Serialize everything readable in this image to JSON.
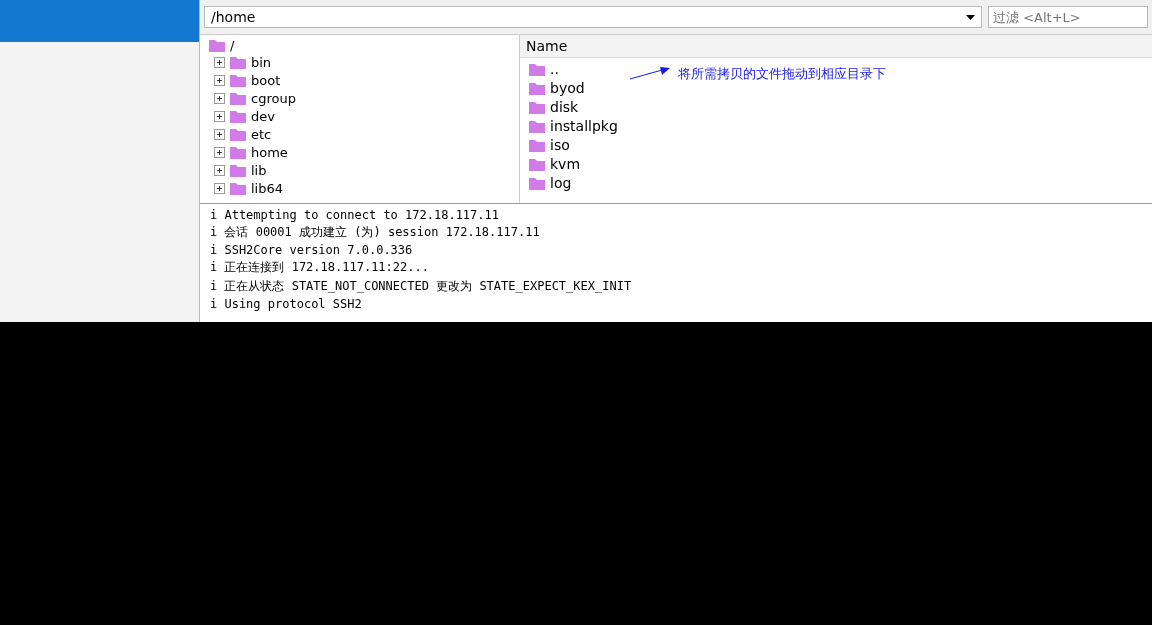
{
  "path_bar": {
    "value": "/home"
  },
  "filter": {
    "placeholder": "过滤 <Alt+L>"
  },
  "tree": {
    "root": "/",
    "children": [
      {
        "label": "bin",
        "expanded": false
      },
      {
        "label": "boot",
        "expanded": false
      },
      {
        "label": "cgroup",
        "expanded": false
      },
      {
        "label": "dev",
        "expanded": false
      },
      {
        "label": "etc",
        "expanded": false
      },
      {
        "label": "home",
        "expanded": false
      },
      {
        "label": "lib",
        "expanded": false
      },
      {
        "label": "lib64",
        "expanded": false
      }
    ]
  },
  "file_list": {
    "columns": [
      "Name"
    ],
    "rows": [
      "..",
      "byod",
      "disk",
      "installpkg",
      "iso",
      "kvm",
      "log"
    ]
  },
  "annotation": "将所需拷贝的文件拖动到相应目录下",
  "log": [
    "i Attempting to connect to 172.18.117.11",
    "i 会话 00001 成功建立 (为) session 172.18.117.11",
    "i SSH2Core version 7.0.0.336",
    "i 正在连接到 172.18.117.11:22...",
    "i 正在从状态 STATE_NOT_CONNECTED 更改为 STATE_EXPECT_KEX_INIT",
    "i Using protocol SSH2"
  ]
}
